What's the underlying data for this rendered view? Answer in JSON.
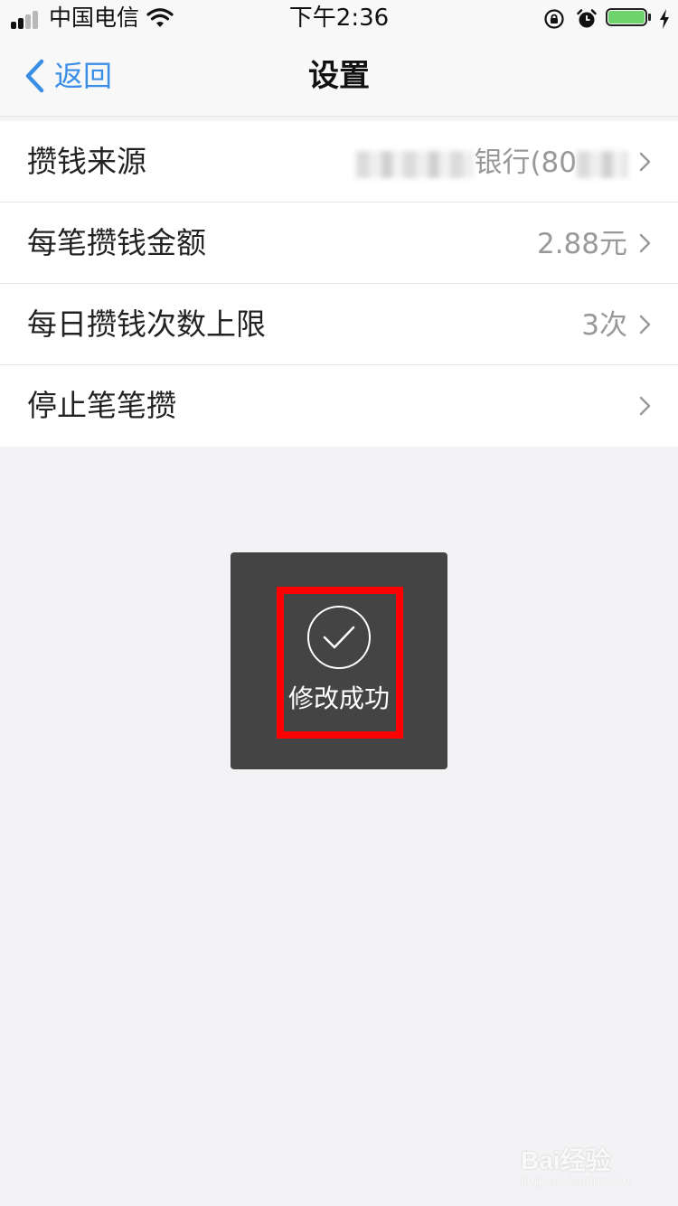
{
  "status_bar": {
    "carrier": "中国电信",
    "time": "下午2:36",
    "icons": [
      "signal-icon",
      "wifi-icon",
      "orientation-lock-icon",
      "alarm-icon",
      "battery-icon",
      "charging-icon"
    ]
  },
  "nav": {
    "back_label": "返回",
    "title": "设置",
    "accent_color": "#3b8ee6"
  },
  "settings": {
    "rows": [
      {
        "label": "攒钱来源",
        "value": "银行(80"
      },
      {
        "label": "每笔攒钱金额",
        "value": "2.88元"
      },
      {
        "label": "每日攒钱次数上限",
        "value": "3次"
      },
      {
        "label": "停止笔笔攒",
        "value": ""
      }
    ]
  },
  "toast": {
    "text": "修改成功",
    "icon": "checkmark-circle-icon",
    "highlight_color": "#ff0000"
  },
  "watermark": {
    "brand": "Bai经验",
    "url": "jingyan.baidu.com"
  }
}
